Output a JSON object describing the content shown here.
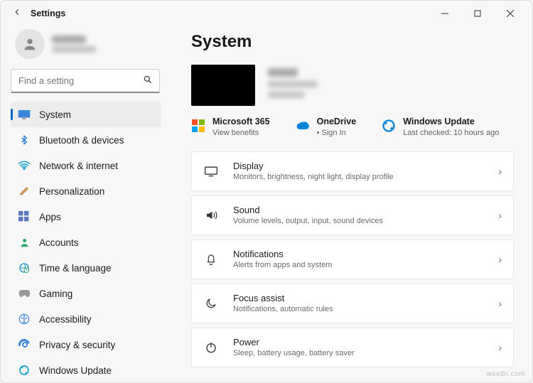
{
  "window": {
    "title": "Settings"
  },
  "search": {
    "placeholder": "Find a setting"
  },
  "sidebar": {
    "items": [
      {
        "label": "System",
        "selected": true
      },
      {
        "label": "Bluetooth & devices"
      },
      {
        "label": "Network & internet"
      },
      {
        "label": "Personalization"
      },
      {
        "label": "Apps"
      },
      {
        "label": "Accounts"
      },
      {
        "label": "Time & language"
      },
      {
        "label": "Gaming"
      },
      {
        "label": "Accessibility"
      },
      {
        "label": "Privacy & security"
      },
      {
        "label": "Windows Update"
      }
    ]
  },
  "page": {
    "title": "System"
  },
  "services": {
    "ms365": {
      "title": "Microsoft 365",
      "sub": "View benefits"
    },
    "onedrive": {
      "title": "OneDrive",
      "sub": "Sign In",
      "bullet": "•"
    },
    "update": {
      "title": "Windows Update",
      "sub": "Last checked: 10 hours ago"
    }
  },
  "cards": [
    {
      "title": "Display",
      "sub": "Monitors, brightness, night light, display profile"
    },
    {
      "title": "Sound",
      "sub": "Volume levels, output, input, sound devices"
    },
    {
      "title": "Notifications",
      "sub": "Alerts from apps and system"
    },
    {
      "title": "Focus assist",
      "sub": "Notifications, automatic rules"
    },
    {
      "title": "Power",
      "sub": "Sleep, battery usage, battery saver"
    }
  ],
  "watermark": "wsxdn.com"
}
